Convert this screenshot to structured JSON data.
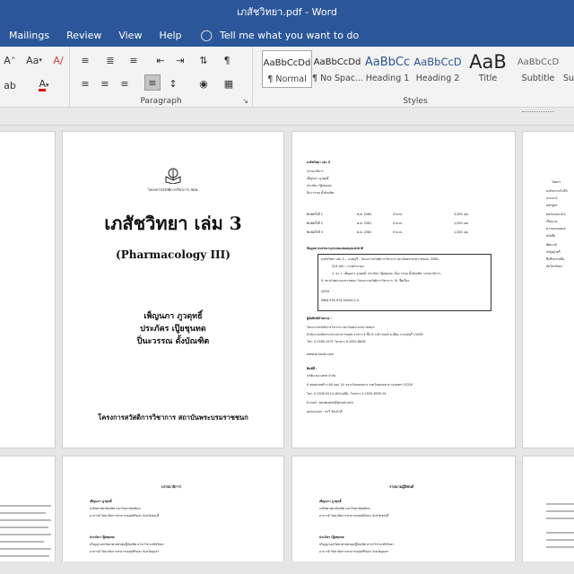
{
  "window": {
    "title": "เภสัชวิทยา.pdf  -  Word"
  },
  "menu": {
    "items": [
      "Mailings",
      "Review",
      "View",
      "Help"
    ],
    "tell_me": "Tell me what you want to do"
  },
  "ribbon": {
    "paragraph_label": "Paragraph",
    "styles_label": "Styles",
    "styles": [
      {
        "preview": "AaBbCcDd",
        "name": "¶ Normal"
      },
      {
        "preview": "AaBbCcDd",
        "name": "¶ No Spac..."
      },
      {
        "preview": "AaBbCc",
        "name": "Heading 1"
      },
      {
        "preview": "AaBbCcD",
        "name": "Heading 2"
      },
      {
        "preview": "AaB",
        "name": "Title"
      },
      {
        "preview": "AaBbCcD",
        "name": "Subtitle"
      },
      {
        "preview": "",
        "name": "Su"
      }
    ],
    "font_size_label": "Aa",
    "font_a": "A"
  },
  "cover": {
    "publisher_small": "โครงการสวัสดิการวิชาการ สบพ.",
    "title": "เภสัชวิทยา เล่ม 3",
    "subtitle": "(Pharmacology III)",
    "authors": [
      "เพ็ญนภา ภูวดุทธิ์",
      "ประภัคร เปู๊ยชุนทด",
      "ปิ่นะวรรณ ดั้งบัณฑิต"
    ],
    "publisher": "โครงการสวัสดิการวิชาการ สถาบันพระบรมราชชนก"
  },
  "copyright_page": {
    "header": "เภสัชวิทยา เล่ม 3",
    "editor_label": "บรรณาธิการ",
    "editors": [
      "เพ็ญนภา ภูวดุทธิ์",
      "ประภัคร เปู๊ยชุนทด",
      "ปิ่นะวรรณ ดั้งบัณฑิต"
    ],
    "prints": [
      {
        "label": "พิมพ์ครั้งที่ 1",
        "year": "พ.ศ. 2560",
        "qty_label": "จำนวน",
        "qty": "3,000 เล่ม"
      },
      {
        "label": "พิมพ์ครั้งที่ 2",
        "year": "พ.ศ. 2561",
        "qty_label": "จำนวน",
        "qty": "1,000 เล่ม"
      },
      {
        "label": "พิมพ์ครั้งที่ 3",
        "year": "พ.ศ. 2562",
        "qty_label": "จำนวน",
        "qty": "1,000 เล่ม"
      }
    ],
    "catalog_header": "ข้อมูลทางบรรณานุกรมของหอสมุดแห่งชาติ",
    "catalog_lines": [
      "เภสัชวิทยา เล่ม 3.-- นนทบุรี : โครงการสวัสดิการวิชาการ สถาบันพระบรมราชชนก, 2560.",
      "224 หน้า : ภาพประกอบ",
      "1. ยา. I. เพ็ญนภา ภูวดุทธิ์, ประภัคร เปู๊ยชุนทด, ปิ่นะวรรณ ดั้งบัณฑิต, บรรณาธิการ.",
      "II. สถาบันพระบรมราชชนก โครงการสวัสดิการวิชาการ. III. ชื่อเรื่อง.",
      "QV55",
      "ISBN 978-974-00943-2-4"
    ],
    "dist_header": "ผู้จัดพิมพ์จำหน่าย :",
    "dist_lines": [
      "โครงการสวัสดิการวิชาการ สถาบันพระบรมราชชนก",
      "สำนักงานปลัดกระทรวงสาธารณสุข อาคาร 4 ชั้น 6 ถ.ติวานนท์ อ.เมือง จ.นนทบุรี 11000",
      "โทร. 0-2590-1971 โทรสาร 0-2591-8626",
      "www.pi-book.com"
    ],
    "printer_header": "พิมพ์ที่ :",
    "printer_lines": [
      "บริษัท ธนาเพรส จำกัด",
      "4 ซอยลาดพร้าว 64 แยก 14 แขวงวังทองหลาง เขตวังทองหลาง กรุงเทพฯ 10310",
      "โทร. 0-2530-6114 (อัตโนมัติ), โทรสาร 0-2530-8035-01",
      "E-mail : tanapress@gmail.com",
      "ออกแบบปก : ชาวี รัตนโกลี"
    ]
  },
  "page_editors": {
    "heading": "บรรณาธิการ",
    "entries": [
      {
        "name": "เพ็ญนภา ภูวดุทธิ์",
        "lines": [
          "เภสัชศาสตรบัณฑิต มหาวิทยาลัยมหิดล",
          "อาจารย์ วิทยาลัยการสาธารณสุขสิรินธร จังหวัดชลบุรี"
        ]
      },
      {
        "name": "ประภัคร เปู๊ยชุนทด",
        "lines": [
          "ปริญญาเอกวิทยาศาสตรดุษฎีบัณฑิต สาขาวิชาเภสัชวิทยา",
          "อาจารย์ วิทยาลัยการสาธารณสุขสิรินธร จังหวัดอุบลฯ"
        ]
      }
    ]
  },
  "page_authors": {
    "heading": "รายนามผู้นิพนธ์",
    "entries": [
      {
        "name": "เพ็ญนภา ภูวดุทธิ์",
        "lines": [
          "เภสัชศาสตรบัณฑิต มหาวิทยาลัยมหิดล",
          "อาจารย์ วิทยาลัยการสาธารณสุขสิรินธร จังหวัดชลบุรี"
        ]
      },
      {
        "name": "ประภัคร เปู๊ยชุนทด",
        "lines": [
          "ปริญญาเอกวิทยาศาสตรดุษฎีบัณฑิต สาขาวิชาเภสัชวิทยา",
          "อาจารย์ วิทยาลัยการสาธารณสุขสิรินธร จังหวัดอุบลฯ"
        ]
      }
    ]
  },
  "side_page_right": {
    "lines": [
      "โดยกร",
      "เภสัชกรรมไปให้",
      "นะแจะนั",
      "หลักสูตร",
      "ต่อนับบนบนไม่",
      "เรียนเกอ",
      "ความดลมหนส",
      "หนังสือ",
      "พัฒนาตั",
      "ปรัญญาตรี",
      "ที่ปรึกษาเหนือ",
      "ปัยไตรบับพา"
    ]
  },
  "colors": {
    "word_blue": "#2b579a",
    "ribbon_bg": "#f3f3f3",
    "canvas_bg": "#e6e6e6"
  }
}
